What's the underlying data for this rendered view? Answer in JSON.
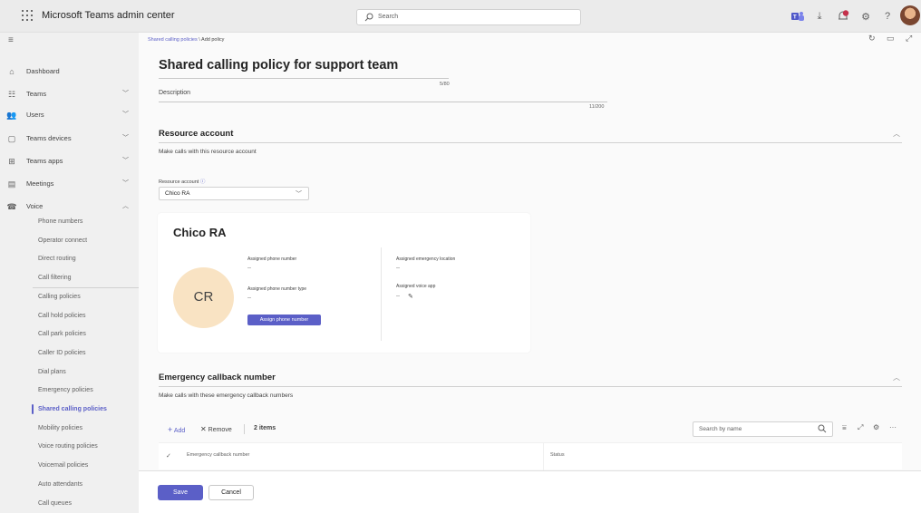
{
  "app": {
    "title": "Microsoft Teams admin center",
    "search_placeholder": "Search",
    "notification_count": "1",
    "help_label": "?"
  },
  "icons": {
    "waffle": "waffle-icon",
    "search": "search-icon",
    "teams": "teams-icon",
    "download": "download-icon",
    "bell": "notifications-icon",
    "settings": "gear-icon",
    "help": "help-icon",
    "account": "avatar"
  },
  "nav": {
    "items": [
      {
        "label": "Dashboard",
        "icon": "home-icon",
        "glyph": "⌂",
        "expandable": false
      },
      {
        "label": "Teams",
        "icon": "teams-group-icon",
        "glyph": "☷",
        "expandable": true
      },
      {
        "label": "Users",
        "icon": "users-icon",
        "glyph": "👥",
        "expandable": true
      },
      {
        "label": "Teams devices",
        "icon": "devices-icon",
        "glyph": "▢",
        "expandable": true
      },
      {
        "label": "Teams apps",
        "icon": "apps-icon",
        "glyph": "⊞",
        "expandable": true
      },
      {
        "label": "Meetings",
        "icon": "meetings-icon",
        "glyph": "▤",
        "expandable": true
      },
      {
        "label": "Voice",
        "icon": "voice-icon",
        "glyph": "☎",
        "expandable": true,
        "expanded": true
      }
    ],
    "voice_sub_items": [
      "Phone numbers",
      "Operator connect",
      "Direct routing",
      "Call filtering",
      "Calling policies",
      "Call hold policies",
      "Call park policies",
      "Caller ID policies",
      "Dial plans",
      "Emergency policies",
      "Shared calling policies",
      "Mobility policies",
      "Voice routing policies",
      "Voicemail policies",
      "Auto attendants",
      "Call queues"
    ],
    "active_sub_item": "Shared calling policies"
  },
  "breadcrumb": {
    "parent": "Shared calling policies",
    "separator": "\\",
    "current": "Add policy"
  },
  "form": {
    "name_value": "Shared calling policy for support team",
    "name_counter": "5/80",
    "description_label": "Description",
    "description_counter": "11/200"
  },
  "resource_section": {
    "title": "Resource account",
    "description": "Make calls with this resource account",
    "field_label": "Resource account",
    "selected_value": "Chico RA",
    "card": {
      "name": "Chico RA",
      "initials": "CR",
      "assigned_phone_number_label": "Assigned phone number",
      "assigned_phone_number_value": "--",
      "assigned_phone_number_type_label": "Assigned phone number type",
      "assigned_phone_number_type_value": "--",
      "assign_button": "Assign phone number",
      "assigned_emergency_location_label": "Assigned emergency location",
      "assigned_emergency_location_value": "--",
      "assigned_voice_app_label": "Assigned voice app",
      "assigned_voice_app_value": "--"
    }
  },
  "emergency_section": {
    "title": "Emergency callback number",
    "description": "Make calls with these emergency callback numbers",
    "add_label": "Add",
    "remove_label": "Remove",
    "item_count": "2 items",
    "search_placeholder": "Search by name",
    "columns": [
      "Emergency callback number",
      "Status"
    ]
  },
  "footer": {
    "save_label": "Save",
    "cancel_label": "Cancel"
  },
  "colors": {
    "accent": "#5b5fc7",
    "avatar_bg": "#f9e3c3",
    "topbar_bg": "#ebebeb",
    "nav_bg": "#f0f0f0",
    "notification": "#c4314b"
  }
}
